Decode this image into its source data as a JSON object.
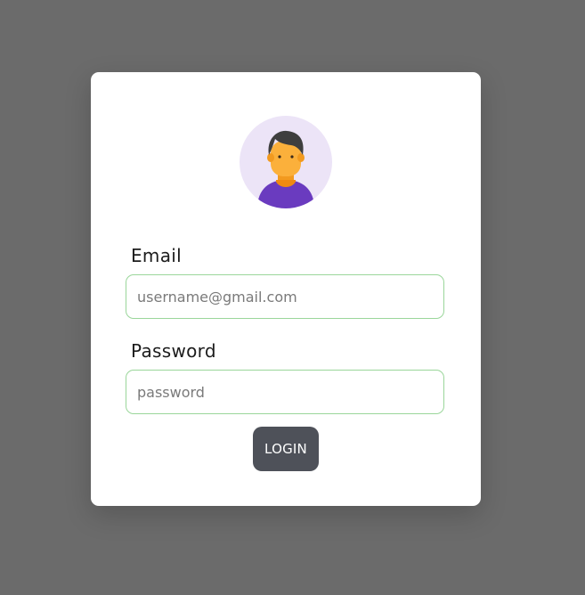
{
  "avatar": {
    "icon": "user-avatar-icon"
  },
  "form": {
    "email_label": "Email",
    "email_placeholder": "username@gmail.com",
    "password_label": "Password",
    "password_placeholder": "password",
    "login_label": "LOGIN"
  },
  "colors": {
    "page_background": "#6b6b6b",
    "card_background": "#ffffff",
    "avatar_background": "#ece4f7",
    "field_border": "#9ad69a",
    "button_background": "#4e5159",
    "button_text": "#ffffff"
  }
}
